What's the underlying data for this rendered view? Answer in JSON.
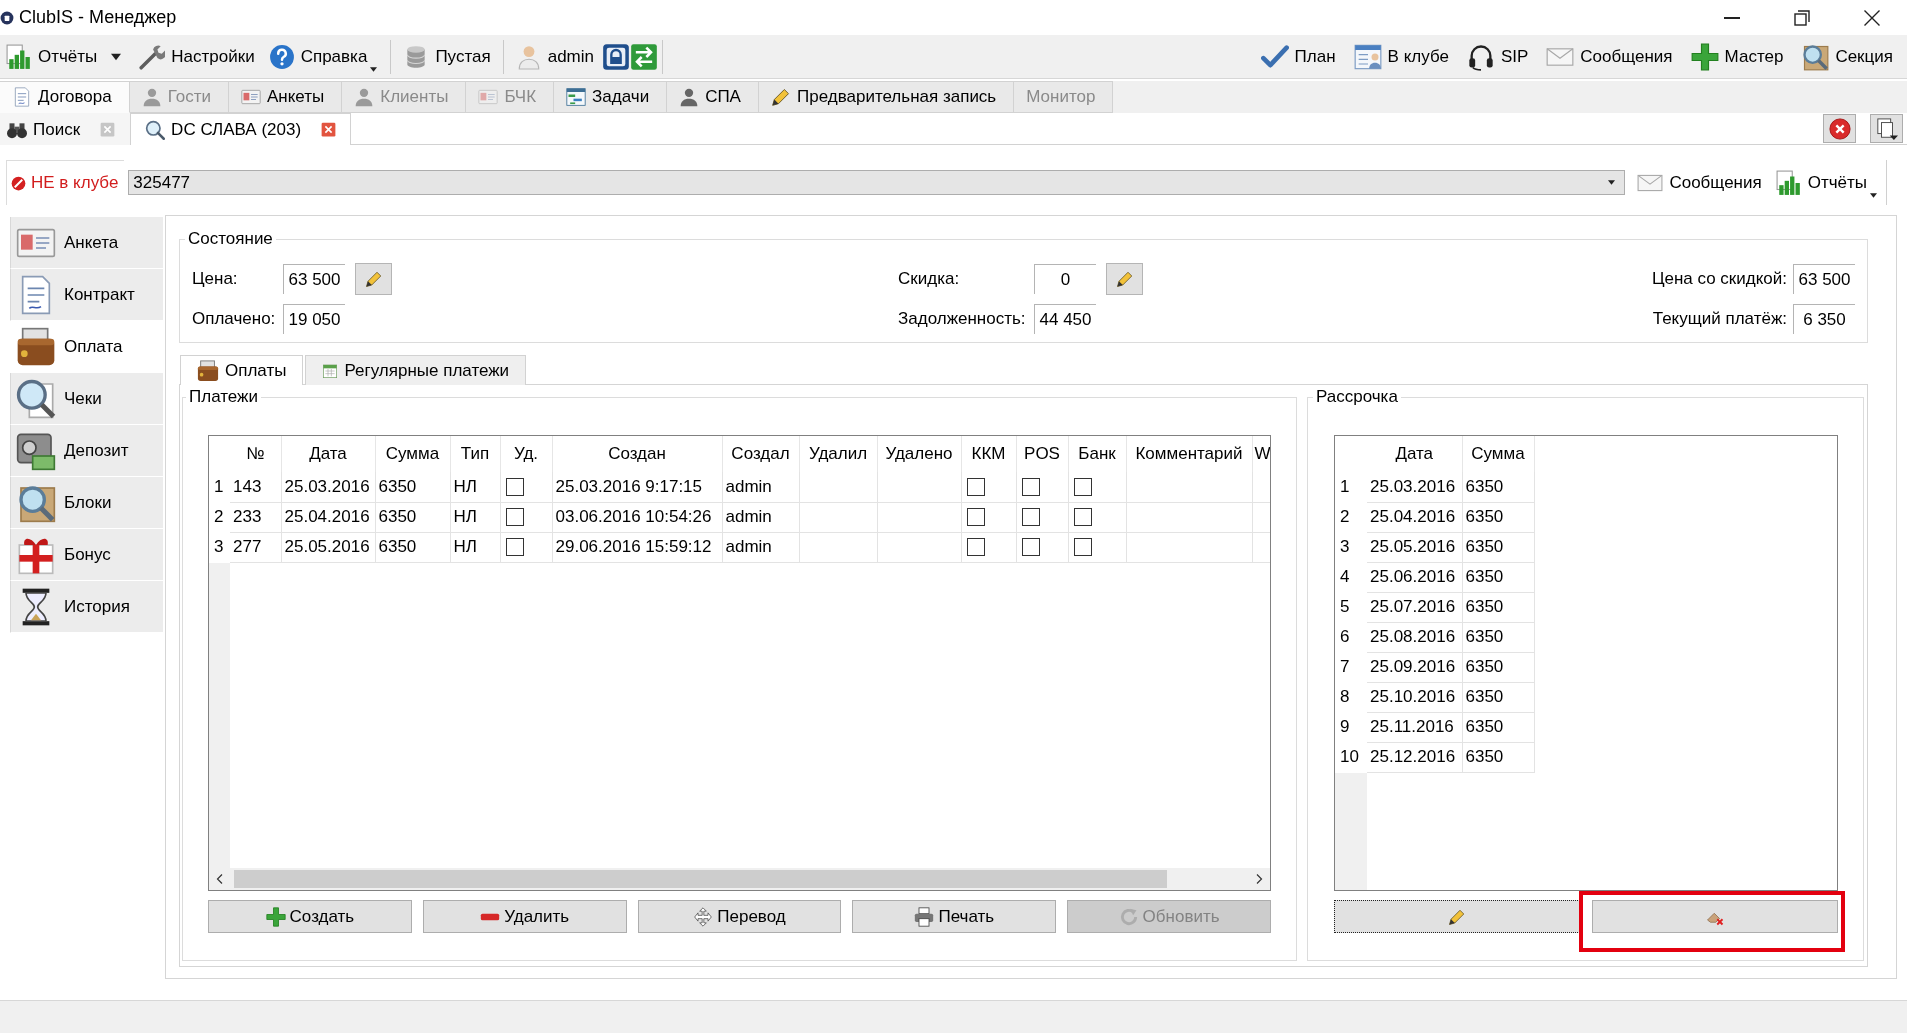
{
  "window": {
    "title": "ClubIS - Менеджер"
  },
  "toolbar": {
    "groups": [
      [
        {
          "kind": "split",
          "label": "Отчёты"
        },
        {
          "kind": "button",
          "label": "Настройки"
        },
        {
          "kind": "menu",
          "label": "Справка"
        }
      ],
      [
        {
          "kind": "button",
          "label": "Пустая"
        }
      ],
      [
        {
          "kind": "button",
          "label": "admin"
        },
        {
          "kind": "icon"
        },
        {
          "kind": "icon"
        }
      ]
    ],
    "right": [
      {
        "label": "План"
      },
      {
        "label": "В клубе"
      },
      {
        "label": "SIP"
      },
      {
        "label": "Сообщения"
      },
      {
        "label": "Мастер"
      },
      {
        "label": "Секция"
      }
    ]
  },
  "main_tabs": [
    {
      "label": "Договора",
      "selected": true,
      "disabled": false
    },
    {
      "label": "Гости",
      "selected": false,
      "disabled": true
    },
    {
      "label": "Анкеты",
      "selected": false,
      "disabled": false
    },
    {
      "label": "Клиенты",
      "selected": false,
      "disabled": true
    },
    {
      "label": "БЧК",
      "selected": false,
      "disabled": true
    },
    {
      "label": "Задачи",
      "selected": false,
      "disabled": false
    },
    {
      "label": "СПА",
      "selected": false,
      "disabled": false
    },
    {
      "label": "Предварительная запись",
      "selected": false,
      "disabled": false
    },
    {
      "label": "Монитор",
      "selected": false,
      "disabled": true
    }
  ],
  "doc_tabs": [
    {
      "label": "Поиск",
      "selected": false
    },
    {
      "label": "DC СЛАВА (203)",
      "selected": true
    }
  ],
  "client": {
    "status": "НЕ в клубе",
    "in_club": false,
    "card_number": "325477",
    "buttons": [
      {
        "kind": "button",
        "label": "Сообщения"
      },
      {
        "kind": "menu",
        "label": "Отчёты"
      }
    ]
  },
  "sidebar": {
    "items": [
      {
        "label": "Анкета",
        "selected": false
      },
      {
        "label": "Контракт",
        "selected": false
      },
      {
        "label": "Оплата",
        "selected": true
      },
      {
        "label": "Чеки",
        "selected": false
      },
      {
        "label": "Депозит",
        "selected": false
      },
      {
        "label": "Блоки",
        "selected": false
      },
      {
        "label": "Бонус",
        "selected": false
      },
      {
        "label": "История",
        "selected": false
      }
    ]
  },
  "state": {
    "title": "Состояние",
    "rows": [
      [
        {
          "label": "Цена:",
          "value": "63 500",
          "editable": true
        },
        {
          "label": "Скидка:",
          "value": "0",
          "editable": true
        },
        {
          "label": "Цена со скидкой:",
          "value": "63 500",
          "editable": false
        }
      ],
      [
        {
          "label": "Оплачено:",
          "value": "19 050",
          "editable": false
        },
        {
          "label": "Задолженность:",
          "value": "44 450",
          "editable": false
        },
        {
          "label": "Текущий платёж:",
          "value": "6 350",
          "editable": false
        }
      ]
    ]
  },
  "sub_tabs": [
    {
      "label": "Оплаты",
      "selected": true
    },
    {
      "label": "Регулярные платежи",
      "selected": false
    }
  ],
  "payments": {
    "title": "Платежи",
    "columns": [
      "№",
      "Дата",
      "Сумма",
      "Тип",
      "Уд.",
      "Создан",
      "Создал",
      "Удалил",
      "Удалено",
      "ККМ",
      "POS",
      "Банк",
      "Комментарий",
      "W"
    ],
    "rows": [
      {
        "index": "1",
        "number": "143",
        "date": "25.03.2016",
        "sum": "6350",
        "type": "НЛ",
        "deleted": false,
        "created": "25.03.2016 9:17:15",
        "created_by": "admin",
        "kkm": false,
        "pos": false,
        "bank": false
      },
      {
        "index": "2",
        "number": "233",
        "date": "25.04.2016",
        "sum": "6350",
        "type": "НЛ",
        "deleted": false,
        "created": "03.06.2016 10:54:26",
        "created_by": "admin",
        "kkm": false,
        "pos": false,
        "bank": false
      },
      {
        "index": "3",
        "number": "277",
        "date": "25.05.2016",
        "sum": "6350",
        "type": "НЛ",
        "deleted": false,
        "created": "29.06.2016 15:59:12",
        "created_by": "admin",
        "kkm": false,
        "pos": false,
        "bank": false
      }
    ],
    "buttons": [
      {
        "label": "Создать",
        "disabled": false
      },
      {
        "label": "Удалить",
        "disabled": false
      },
      {
        "label": "Перевод",
        "disabled": false
      },
      {
        "label": "Печать",
        "disabled": false
      },
      {
        "label": "Обновить",
        "disabled": true
      }
    ]
  },
  "installments": {
    "title": "Рассрочка",
    "columns": [
      "Дата",
      "Сумма"
    ],
    "rows": [
      {
        "index": "1",
        "date": "25.03.2016",
        "sum": "6350"
      },
      {
        "index": "2",
        "date": "25.04.2016",
        "sum": "6350"
      },
      {
        "index": "3",
        "date": "25.05.2016",
        "sum": "6350"
      },
      {
        "index": "4",
        "date": "25.06.2016",
        "sum": "6350"
      },
      {
        "index": "5",
        "date": "25.07.2016",
        "sum": "6350"
      },
      {
        "index": "6",
        "date": "25.08.2016",
        "sum": "6350"
      },
      {
        "index": "7",
        "date": "25.09.2016",
        "sum": "6350"
      },
      {
        "index": "8",
        "date": "25.10.2016",
        "sum": "6350"
      },
      {
        "index": "9",
        "date": "25.11.2016",
        "sum": "6350"
      },
      {
        "index": "10",
        "date": "25.12.2016",
        "sum": "6350"
      }
    ],
    "buttons": [
      {
        "kind": "edit",
        "focused": true,
        "highlighted": false
      },
      {
        "kind": "clear",
        "focused": false,
        "highlighted": true
      }
    ]
  }
}
